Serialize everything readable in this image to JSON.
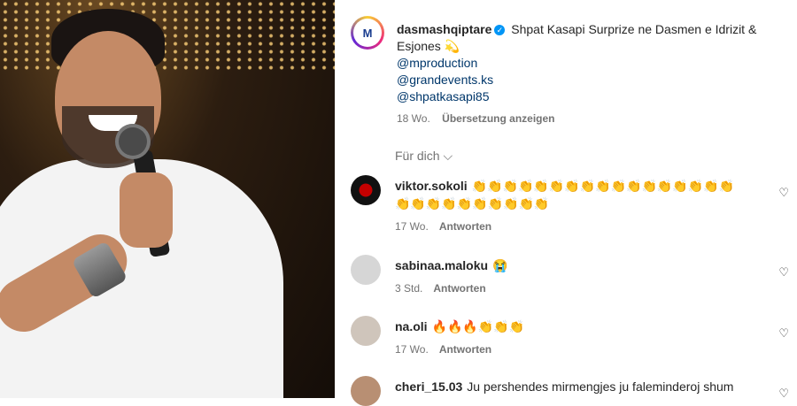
{
  "post": {
    "username": "dasmashqiptare",
    "avatar_text": "M",
    "caption": "Shpat Kasapi Surprize ne Dasmen e Idrizit & Esjones 💫",
    "mentions": [
      "@mproduction",
      "@grandevents.ks",
      "@shpatkasapi85"
    ],
    "age": "18 Wo.",
    "translate_label": "Übersetzung anzeigen"
  },
  "filter_label": "Für dich ⌵",
  "comments": [
    {
      "user": "viktor.sokoli",
      "text": "👏👏👏👏👏👏👏👏👏👏👏👏👏👏👏👏👏👏👏👏👏👏👏👏👏👏👏",
      "age": "17 Wo.",
      "reply": "Antworten"
    },
    {
      "user": "sabinaa.maloku",
      "text": "😭",
      "age": "3 Std.",
      "reply": "Antworten"
    },
    {
      "user": "na.oli",
      "text": "🔥🔥🔥👏👏👏",
      "age": "17 Wo.",
      "reply": "Antworten"
    },
    {
      "user": "cheri_15.03",
      "text": "Ju pershendes mirmengjes ju faleminderoj shum",
      "age": "",
      "reply": ""
    }
  ],
  "icons": {
    "like": "heart-icon",
    "verified": "verified-badge-icon"
  }
}
